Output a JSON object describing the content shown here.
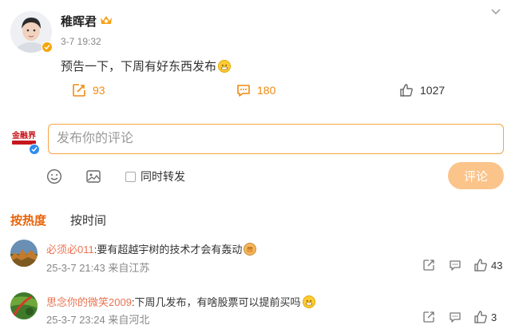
{
  "post": {
    "author": "稚晖君",
    "time": "3-7 19:32",
    "text": "预告一下，下周有好东西发布",
    "icons": [
      "avatar",
      "verified-badge",
      "member-crown-icon",
      "grin-emoji",
      "chevron-down-icon"
    ]
  },
  "actions": {
    "repost_count": "93",
    "comment_count": "180",
    "like_count": "1027",
    "icons": [
      "repost-icon",
      "comment-icon",
      "like-icon"
    ]
  },
  "composer": {
    "logo_text": "金融界",
    "placeholder": "发布你的评论",
    "repost_label": "同时转发",
    "send_label": "评论",
    "icons": [
      "emoji-icon",
      "image-icon"
    ]
  },
  "tabs": {
    "hot": "按热度",
    "time": "按时间"
  },
  "comments": [
    {
      "user": "必须必011",
      "text": ":要有超越宇树的技术才会有轰动",
      "emoji": "fist-emoji",
      "time": "25-3-7 21:43",
      "location": "来自江苏",
      "likes": "43"
    },
    {
      "user": "思念你的微笑2009",
      "text": ":下周几发布，有啥股票可以提前买吗",
      "emoji": "grin-emoji",
      "time": "25-3-7 23:24",
      "location": "来自河北",
      "likes": "3"
    }
  ],
  "colors": {
    "accent": "#e8630a",
    "action": "#f08a12",
    "username": "#eb7350",
    "input_border": "#f7a445",
    "send_button": "#fbc48a",
    "verified": "#f6a50c"
  }
}
